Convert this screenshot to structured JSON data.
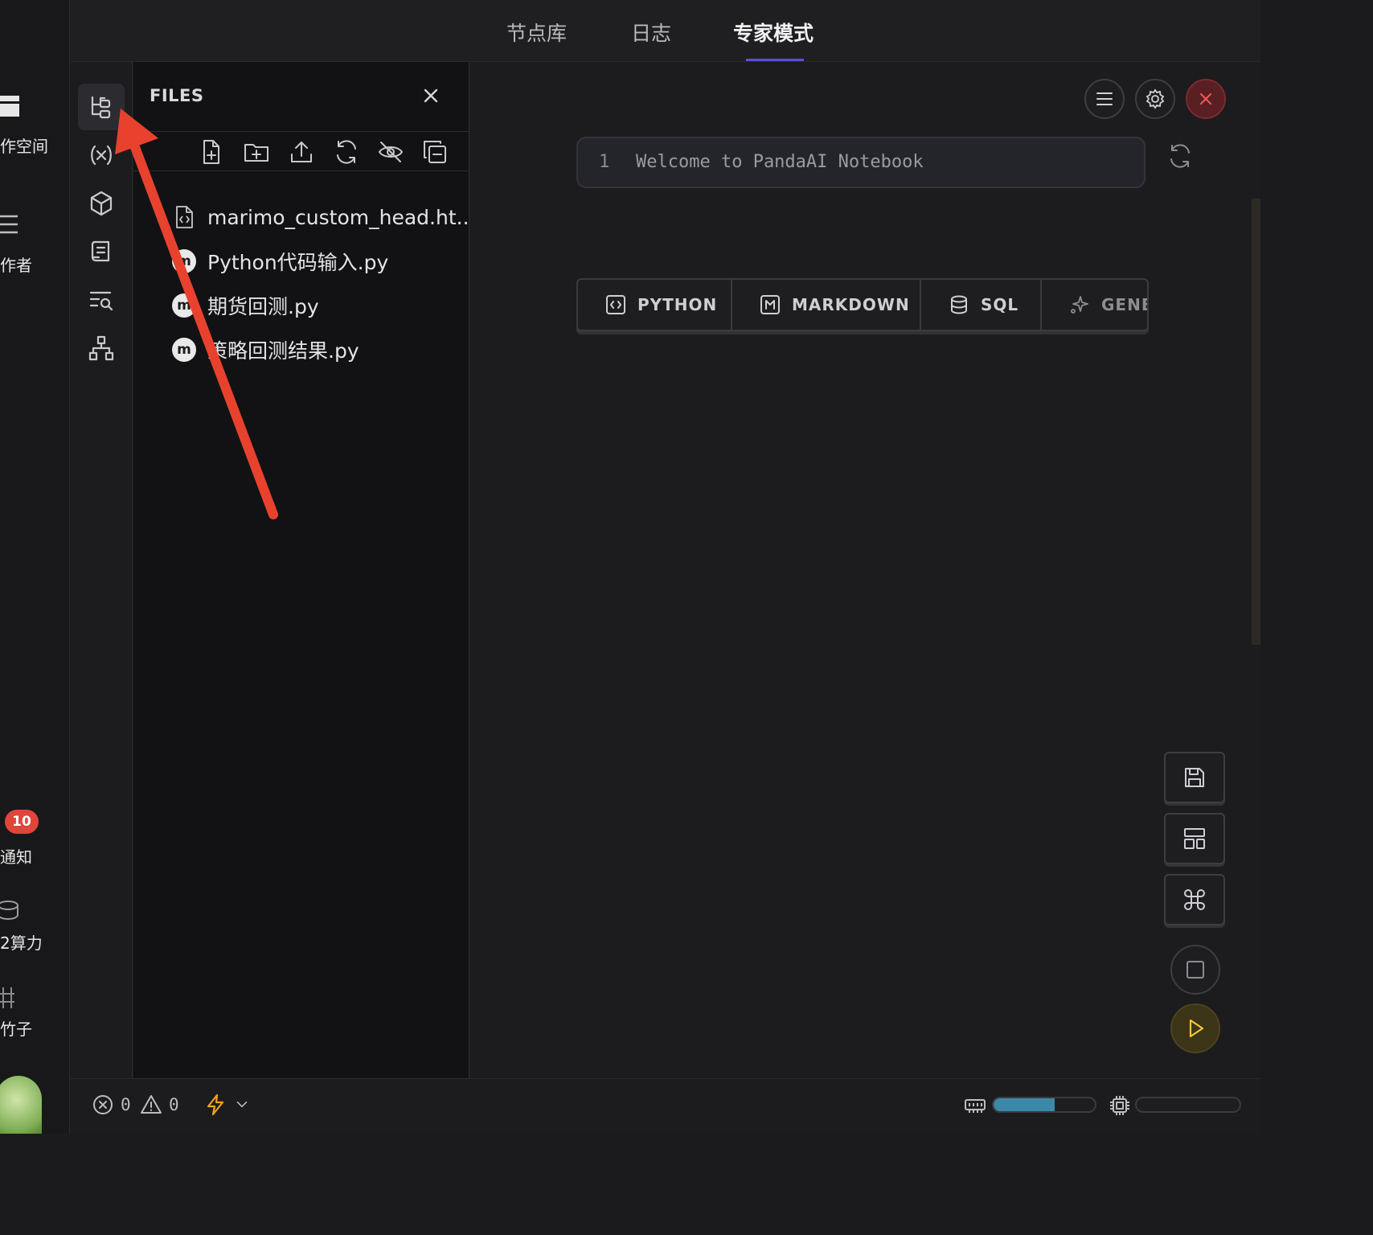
{
  "app_rail": {
    "items": [
      {
        "label": "作空间"
      },
      {
        "label": "作者"
      },
      {
        "label": "通知",
        "badge": "10"
      },
      {
        "label": "2算力"
      },
      {
        "label": "竹子"
      }
    ]
  },
  "topbar": {
    "tabs": [
      {
        "label": "节点库",
        "active": false
      },
      {
        "label": "日志",
        "active": false
      },
      {
        "label": "专家模式",
        "active": true
      }
    ]
  },
  "activity": {
    "items": [
      "file-tree-icon",
      "variables-icon",
      "package-icon",
      "scroll-icon",
      "search-list-icon",
      "dependency-graph-icon"
    ]
  },
  "files": {
    "title": "FILES",
    "toolbar": [
      "new-file-icon",
      "new-folder-icon",
      "upload-icon",
      "refresh-icon",
      "hide-icon",
      "collapse-icon"
    ],
    "items": [
      {
        "name": "marimo_custom_head.ht...",
        "icon": "html-file-icon"
      },
      {
        "name": "Python代码输入.py",
        "icon": "marimo-icon"
      },
      {
        "name": "期货回测.py",
        "icon": "marimo-icon"
      },
      {
        "name": "策略回测结果.py",
        "icon": "marimo-icon"
      }
    ]
  },
  "notebook": {
    "cell": {
      "line_number": "1",
      "code": "Welcome to PandaAI Notebook"
    },
    "cell_types": [
      {
        "label": "PYTHON",
        "icon": "code-icon"
      },
      {
        "label": "MARKDOWN",
        "icon": "markdown-icon"
      },
      {
        "label": "SQL",
        "icon": "database-icon"
      },
      {
        "label": "GENE",
        "icon": "sparkle-icon"
      }
    ]
  },
  "status": {
    "errors": "0",
    "warnings": "0",
    "memory_fraction": 0.6,
    "cpu_fraction": 0.0
  },
  "colors": {
    "accent": "#5b4fe0",
    "annotation_arrow": "#e8422f",
    "badge": "#e0453a",
    "progress": "#3d87a8"
  }
}
